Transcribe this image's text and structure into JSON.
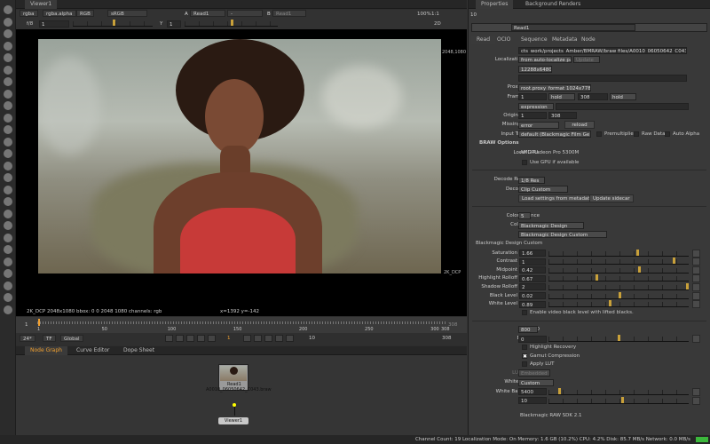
{
  "viewer": {
    "tab": "Viewer1",
    "channels": "rgba",
    "alpha": "rgba.alpha",
    "rgb": "RGB",
    "colorspace": "sRGB",
    "input_a_label": "A",
    "input_a": "Read1",
    "input_op": "-",
    "input_b_label": "B",
    "input_b": "Read1",
    "zoom": "100%",
    "ratio": "1:1",
    "fstop": "f/8",
    "frame_gain": "1",
    "gamma_label": "Y",
    "gamma": "1",
    "view_mode": "2D",
    "format_overlay": "2048,1080",
    "format_label": "2K_DCP",
    "info": "2K_DCP 2048x1080  bbox: 0 0 2048 1080 channels: rgb",
    "coords": "x=1392 y=-142"
  },
  "timeline": {
    "start": "1",
    "end": "308",
    "ticks": [
      "1",
      "50",
      "100",
      "150",
      "200",
      "250",
      "300",
      "308"
    ],
    "current_frame": "1",
    "playhead_fraction": 0.0,
    "fps": "24*",
    "tf": "TF",
    "scope": "Global",
    "step": "10",
    "end_field": "308"
  },
  "nodegraph": {
    "tabs": [
      "Node Graph",
      "Curve Editor",
      "Dope Sheet"
    ],
    "read_node": "Read1",
    "read_sub": "A0010_06050642_C043.braw",
    "viewer_node": "Viewer1"
  },
  "properties": {
    "tabs": [
      "Properties",
      "Background Renders"
    ],
    "max_panels": "10",
    "node_name": "Read1",
    "node_tabs": [
      "Read",
      "OCIO",
      "Sequence",
      "Metadata",
      "Node"
    ],
    "file": "cts_work/projects_Amber/BMRAW/braw files/A0010_06050642_C043.braw",
    "localization_policy": "from auto-localize path",
    "update_btn": "Update",
    "format": "12288x6480",
    "proxy": "",
    "proxy_format": "root.proxy_format 1024x778",
    "frame_range_start": "1",
    "frame_range_before": "hold",
    "frame_range_end": "308",
    "frame_range_after": "hold",
    "frame": "expression",
    "original_range_start": "1",
    "original_range_end": "308",
    "missing_frames": "error",
    "reload": "reload",
    "input_transform": "default (Blackmagic Film Ge",
    "premultiplied": "Premultiplied",
    "raw_data": "Raw Data",
    "auto_alpha": "Auto Alpha",
    "braw_options": "BRAW Options",
    "local_gpu": "AMD Radeon Pro 5300M",
    "use_gpu": "Use GPU if available",
    "decode_resolution": "1/8 Res",
    "decode_using": "Clip Custom",
    "load_settings": "Load settings from metadata",
    "update_sidecar": "Update sidecar",
    "color_science": "5",
    "color_space": "Blackmagic Design",
    "gamma": "Blackmagic Design Custom",
    "custom_group": "Blackmagic Design Custom",
    "sliders": [
      {
        "label": "Saturation",
        "value": "1.66",
        "fraction": 0.64
      },
      {
        "label": "Contrast",
        "value": "1",
        "fraction": 0.9
      },
      {
        "label": "Midpoint",
        "value": "0.42",
        "fraction": 0.65
      },
      {
        "label": "Highlight Rolloff",
        "value": "0.67",
        "fraction": 0.34
      },
      {
        "label": "Shadow Rolloff",
        "value": "2",
        "fraction": 1.0
      },
      {
        "label": "Black Level",
        "value": "0.02",
        "fraction": 0.51
      },
      {
        "label": "White Level",
        "value": "0.89",
        "fraction": 0.44
      }
    ],
    "enable_video_black": "Enable video black level with lifted blacks.",
    "iso": "800",
    "exposure": "0",
    "exposure_fraction": 0.5,
    "highlight_recovery": "Highlight Recovery",
    "gamut_compression": "Gamut Compression",
    "apply_lut": "Apply LUT",
    "lut_source": "Embedded",
    "white_balance": "Custom",
    "white_balance_k": "5400",
    "white_balance_k_fraction": 0.07,
    "tint": "10",
    "tint_fraction": 0.53,
    "sdk": "Blackmagic RAW SDK 2.1",
    "labels": {
      "file": "File",
      "localization_policy": "Localization Policy",
      "format": "Format",
      "proxy": "Proxy",
      "proxy_format": "Proxy Format",
      "frame_range": "Frame Range",
      "frame": "Frame",
      "original_range": "Original Range",
      "missing_frames": "Missing Frames",
      "input_transform": "Input Transform",
      "local_gpu": "Local GPU:",
      "decode_resolution": "Decode Resolution",
      "decode_using": "Decode Using",
      "color_science": "Color Science",
      "color_space": "Color Space",
      "gamma": "Gamma",
      "iso": "ISO",
      "exposure": "Exposure",
      "lut_source": "LUT Source",
      "white_balance": "White Balance",
      "white_balance_k": "White Balance (K)",
      "tint": "Tint"
    }
  },
  "status": "Channel Count: 19 Localization Mode: On Memory: 1.6 GB (10.2%) CPU: 4.2% Disk: 85.7 MB/s Network: 0.0 MB/s",
  "colors": {
    "accent": "#f0a030",
    "knob": "#c9a13a",
    "status_ok": "#3cb83c"
  }
}
